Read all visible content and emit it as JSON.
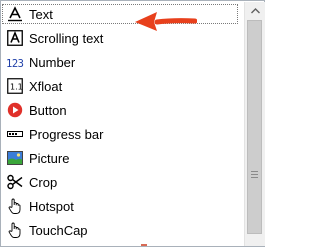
{
  "items": [
    {
      "label": "Text",
      "icon": "text-a-underline-icon"
    },
    {
      "label": "Scrolling text",
      "icon": "scrolling-text-icon"
    },
    {
      "label": "Number",
      "icon": "number-123-icon"
    },
    {
      "label": "Xfloat",
      "icon": "xfloat-icon"
    },
    {
      "label": "Button",
      "icon": "button-play-icon"
    },
    {
      "label": "Progress bar",
      "icon": "progress-bar-icon"
    },
    {
      "label": "Picture",
      "icon": "picture-icon"
    },
    {
      "label": "Crop",
      "icon": "scissors-icon"
    },
    {
      "label": "Hotspot",
      "icon": "hand-pointer-icon"
    },
    {
      "label": "TouchCap",
      "icon": "hand-pointer-icon"
    }
  ],
  "selected_index": 0,
  "colors": {
    "arrow": "#e8401c",
    "number_icon": "#1f3fa8",
    "button_icon": "#e0312a",
    "picture_sky": "#3b7dd8",
    "picture_grass": "#3aa63a"
  }
}
